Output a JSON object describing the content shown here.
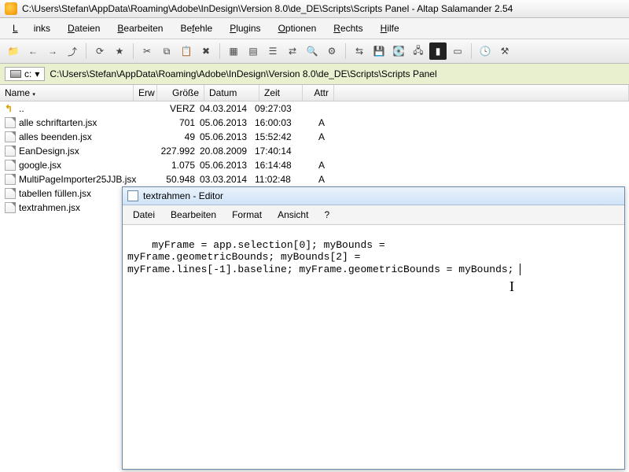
{
  "titlebar": {
    "path": "C:\\Users\\Stefan\\AppData\\Roaming\\Adobe\\InDesign\\Version 8.0\\de_DE\\Scripts\\Scripts Panel - Altap Salamander 2.54"
  },
  "menu": {
    "links": "Links",
    "dateien": "Dateien",
    "bearbeiten": "Bearbeiten",
    "befehle": "Befehle",
    "plugins": "Plugins",
    "optionen": "Optionen",
    "rechts": "Rechts",
    "hilfe": "Hilfe"
  },
  "pathbar": {
    "drive": "c:",
    "path": "C:\\Users\\Stefan\\AppData\\Roaming\\Adobe\\InDesign\\Version 8.0\\de_DE\\Scripts\\Scripts Panel"
  },
  "cols": {
    "name": "Name",
    "erw": "Erw",
    "gro": "Größe",
    "dat": "Datum",
    "zeit": "Zeit",
    "attr": "Attr"
  },
  "files": [
    {
      "up": true,
      "name": "..",
      "size": "VERZ",
      "date": "04.03.2014",
      "time": "09:27:03",
      "attr": ""
    },
    {
      "name": "alle schriftarten.jsx",
      "size": "701",
      "date": "05.06.2013",
      "time": "16:00:03",
      "attr": "A"
    },
    {
      "name": "alles beenden.jsx",
      "size": "49",
      "date": "05.06.2013",
      "time": "15:52:42",
      "attr": "A"
    },
    {
      "name": "EanDesign.jsx",
      "size": "227.992",
      "date": "20.08.2009",
      "time": "17:40:14",
      "attr": ""
    },
    {
      "name": "google.jsx",
      "size": "1.075",
      "date": "05.06.2013",
      "time": "16:14:48",
      "attr": "A"
    },
    {
      "name": "MultiPageImporter25JJB.jsx",
      "size": "50.948",
      "date": "03.03.2014",
      "time": "11:02:48",
      "attr": "A"
    },
    {
      "name": "tabellen füllen.jsx",
      "size": "",
      "date": "",
      "time": "",
      "attr": ""
    },
    {
      "name": "textrahmen.jsx",
      "size": "",
      "date": "",
      "time": "",
      "attr": ""
    }
  ],
  "editor": {
    "title": "textrahmen - Editor",
    "menu": {
      "datei": "Datei",
      "bearbeiten": "Bearbeiten",
      "format": "Format",
      "ansicht": "Ansicht",
      "help": "?"
    },
    "content": "myFrame = app.selection[0]; myBounds =\nmyFrame.geometricBounds; myBounds[2] =\nmyFrame.lines[-1].baseline; myFrame.geometricBounds = myBounds; "
  }
}
